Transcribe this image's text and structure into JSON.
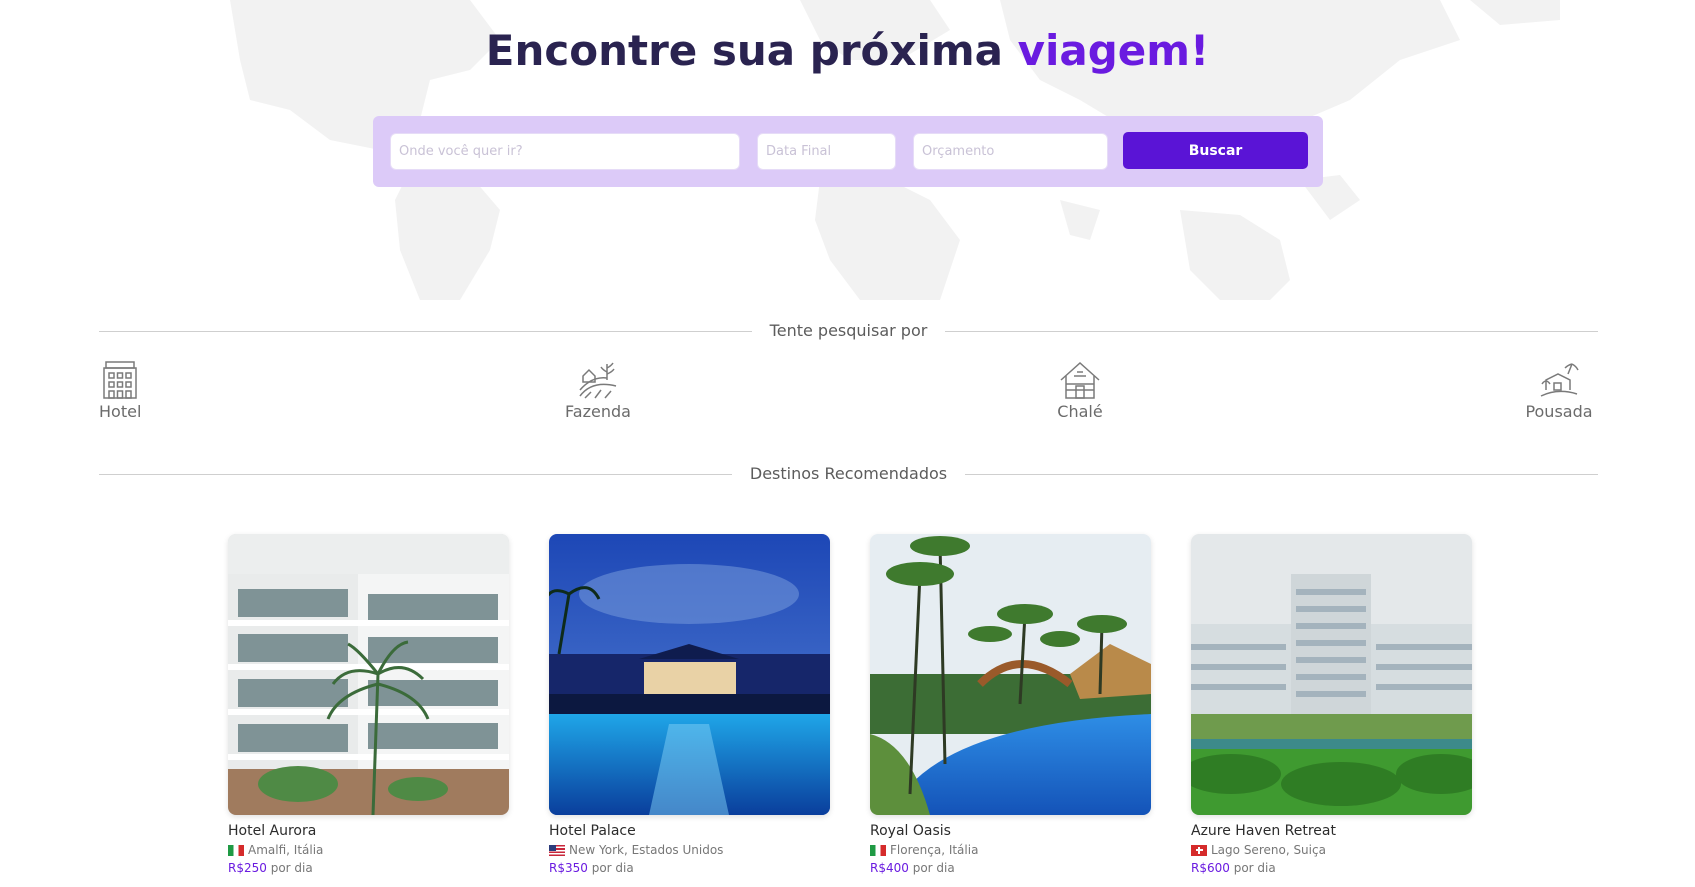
{
  "hero": {
    "title_main": "Encontre sua próxima ",
    "title_accent": "viagem!",
    "accent_color": "#6a1be0"
  },
  "search": {
    "destination_placeholder": "Onde você quer ir?",
    "date_placeholder": "Data Final",
    "budget_placeholder": "Orçamento",
    "button_label": "Buscar",
    "button_color": "#5a14d6"
  },
  "categories": {
    "heading": "Tente pesquisar por",
    "items": [
      {
        "label": "Hotel",
        "icon": "hotel-icon"
      },
      {
        "label": "Fazenda",
        "icon": "farm-icon"
      },
      {
        "label": "Chalé",
        "icon": "cabin-icon"
      },
      {
        "label": "Pousada",
        "icon": "inn-icon"
      }
    ]
  },
  "destinations": {
    "heading": "Destinos Recomendados",
    "cards": [
      {
        "name": "Hotel Aurora",
        "location": "Amalfi, Itália",
        "flag": "italy-flag",
        "price": "R$250",
        "price_suffix": "por dia"
      },
      {
        "name": "Hotel Palace",
        "location": "New York, Estados Unidos",
        "flag": "usa-flag",
        "price": "R$350",
        "price_suffix": "por dia"
      },
      {
        "name": "Royal Oasis",
        "location": "Florença, Itália",
        "flag": "italy-flag",
        "price": "R$400",
        "price_suffix": "por dia"
      },
      {
        "name": "Azure Haven Retreat",
        "location": "Lago Sereno, Suiça",
        "flag": "switzerland-flag",
        "price": "R$600",
        "price_suffix": "por dia"
      }
    ]
  }
}
